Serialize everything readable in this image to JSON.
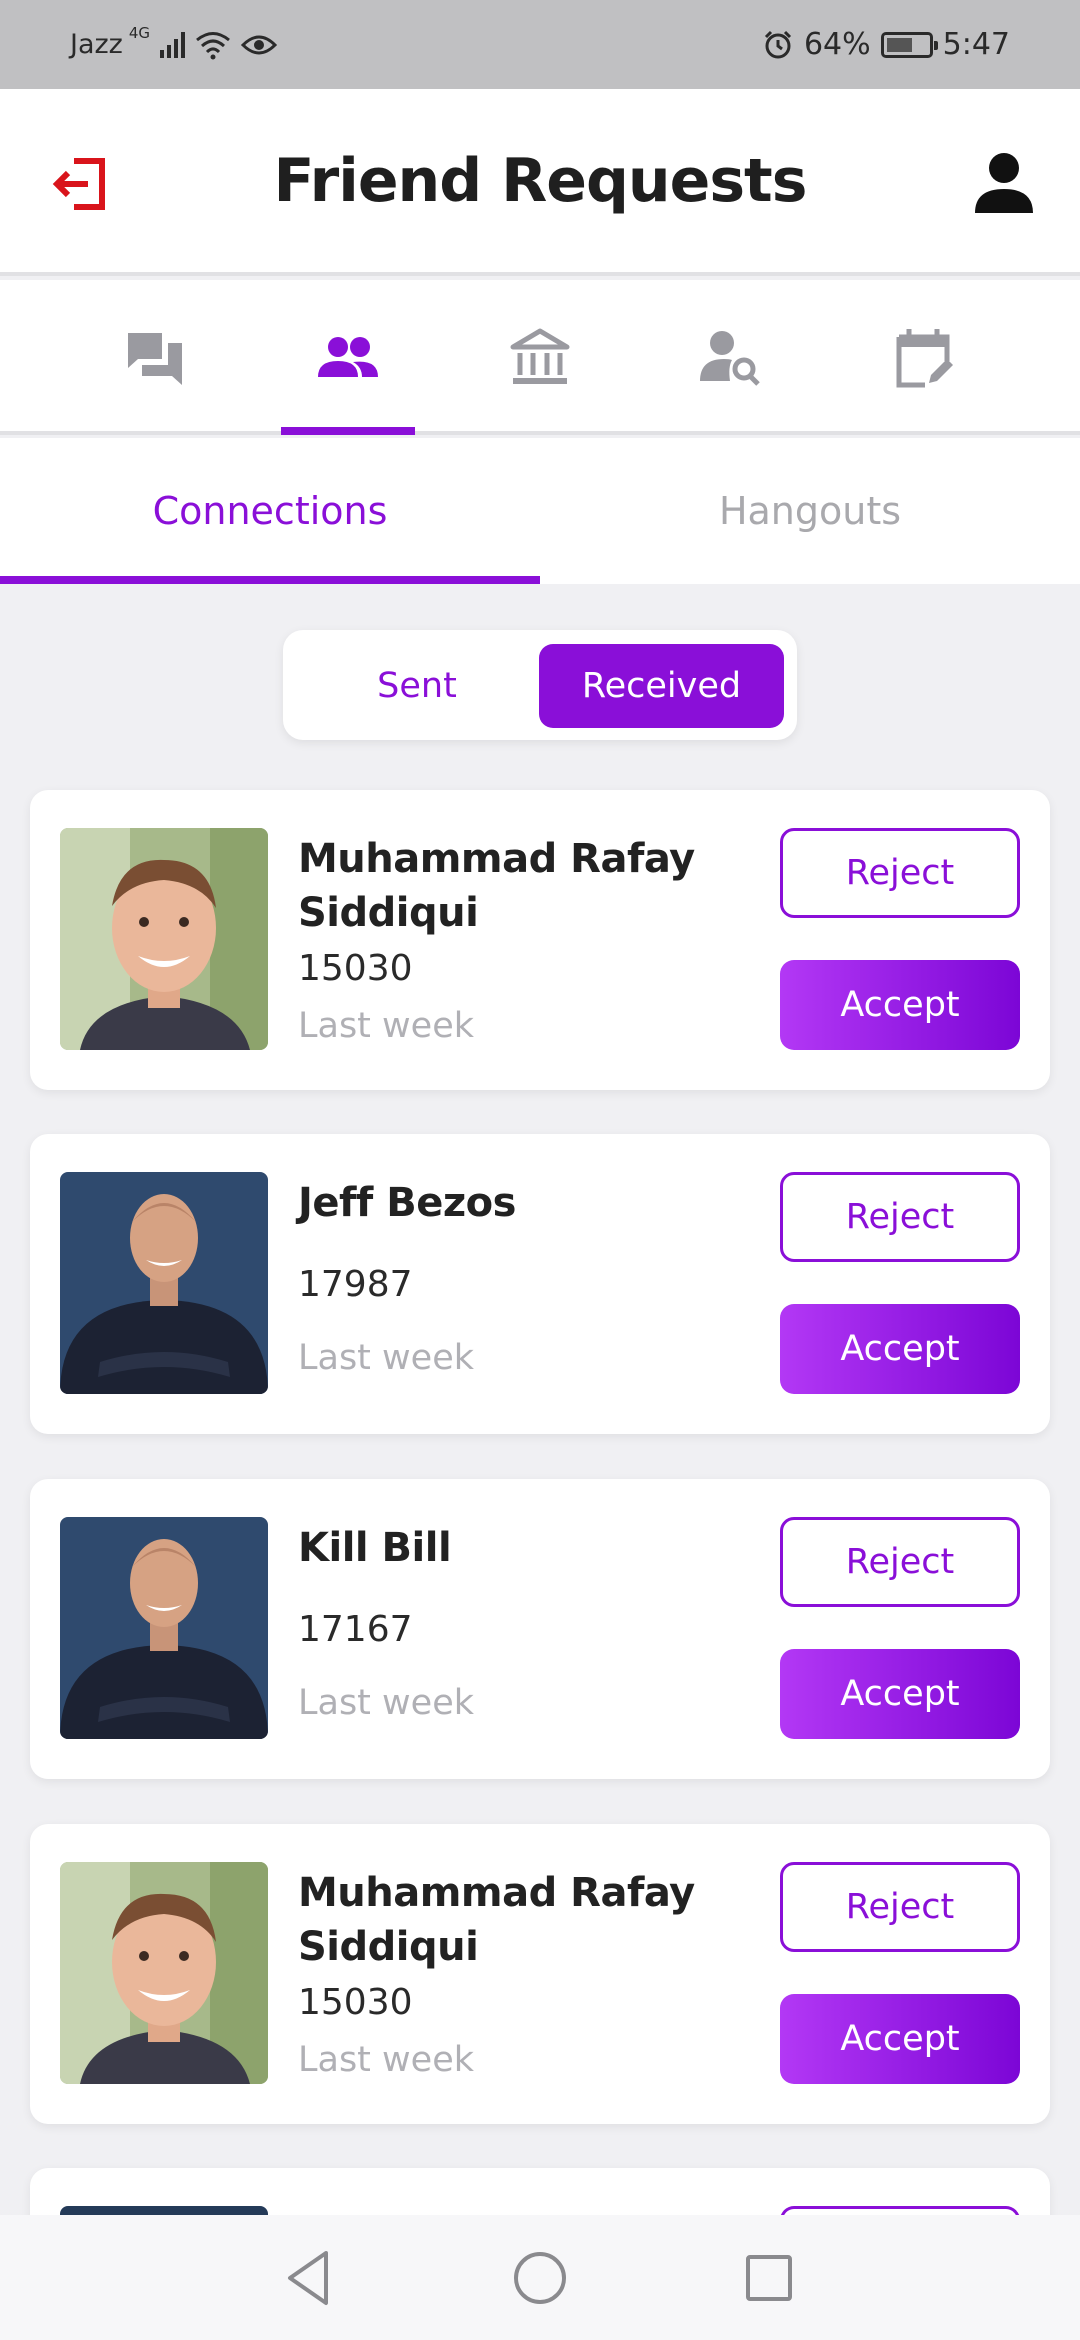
{
  "status_bar": {
    "carrier": "Jazz",
    "network": "4G",
    "battery": "64%",
    "battery_level": 0.64,
    "time": "5:47"
  },
  "header": {
    "title": "Friend Requests"
  },
  "icon_tabs": [
    {
      "icon": "chat-icon"
    },
    {
      "icon": "people-icon",
      "active": true
    },
    {
      "icon": "bank-icon"
    },
    {
      "icon": "person-search-icon"
    },
    {
      "icon": "calendar-edit-icon"
    }
  ],
  "sub_tabs": {
    "connections": "Connections",
    "hangouts": "Hangouts",
    "active": "Connections"
  },
  "toggle": {
    "sent": "Sent",
    "received": "Received",
    "selected": "Received"
  },
  "actions": {
    "reject": "Reject",
    "accept": "Accept"
  },
  "requests": [
    {
      "name": "Muhammad Rafay Siddiqui",
      "id": "15030",
      "time": "Last week"
    },
    {
      "name": "Jeff Bezos",
      "id": "17987",
      "time": "Last week"
    },
    {
      "name": "Kill Bill",
      "id": "17167",
      "time": "Last week"
    },
    {
      "name": "Muhammad Rafay Siddiqui",
      "id": "15030",
      "time": "Last week"
    }
  ],
  "colors": {
    "accent": "#8a0fd8",
    "logout": "#d9141b",
    "inactive_icon": "#9a9aa0"
  }
}
